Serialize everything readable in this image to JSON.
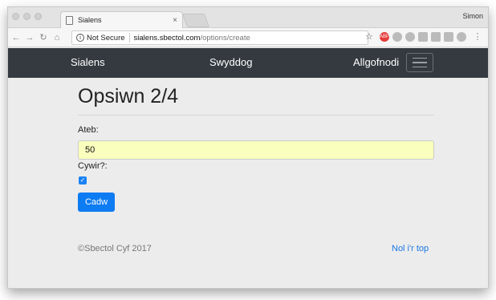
{
  "browser": {
    "tab_title": "Sialens",
    "tab_close": "×",
    "user": "Simon",
    "security_label": "Not Secure",
    "url_host": "sialens.sbectol.com",
    "url_path": "/options/create",
    "ext_abp": "ABP"
  },
  "nav": {
    "brand": "Sialens",
    "middle": "Swyddog",
    "logout": "Allgofnodi"
  },
  "page": {
    "heading": "Opsiwn 2/4",
    "answer_label": "Ateb:",
    "answer_value": "50",
    "correct_label": "Cywir?:",
    "correct_checked": true,
    "save_button": "Cadw"
  },
  "footer": {
    "copyright": "©Sbectol Cyf 2017",
    "back_to_top": "Nol i'r top"
  },
  "colors": {
    "navbar": "#343a40",
    "primary": "#0d7bf2",
    "autofill": "#faffbd",
    "link": "#1a78e6"
  }
}
